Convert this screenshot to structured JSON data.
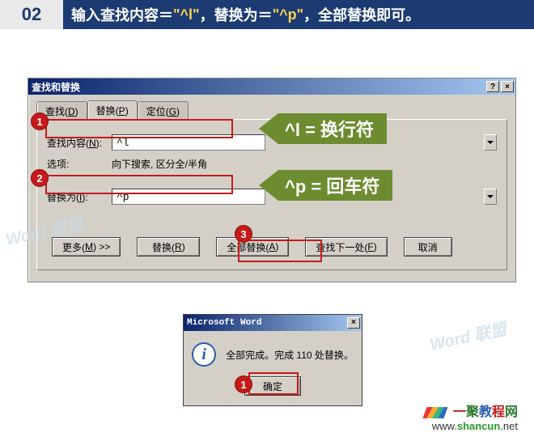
{
  "header": {
    "step": "02",
    "instruction_prefix": "输入查找内容＝",
    "find_quoted": "\"^l\"",
    "instruction_mid": "，替换为＝",
    "replace_quoted": "\"^p\"",
    "instruction_suffix": "，全部替换即可。"
  },
  "dialog": {
    "title": "查找和替换",
    "help_btn": "?",
    "close_btn": "×",
    "tabs": {
      "find": "查找(D)",
      "replace": "替换(P)",
      "goto": "定位(G)"
    },
    "find_label": "查找内容(N):",
    "find_value": "^l",
    "options_label": "选项:",
    "options_value": "向下搜索, 区分全/半角",
    "replace_label": "替换为(I):",
    "replace_value": "^p",
    "buttons": {
      "more": "更多(M) >>",
      "replace": "替换(R)",
      "replace_all": "全部替换(A)",
      "find_next": "查找下一处(F)",
      "cancel": "取消"
    }
  },
  "callouts": {
    "c1": "^l = 换行符",
    "c2": "^p = 回车符"
  },
  "badges": {
    "b1": "1",
    "b2": "2",
    "b3": "3",
    "msg_b1": "1"
  },
  "msgbox": {
    "title": "Microsoft Word",
    "close_btn": "×",
    "icon_letter": "i",
    "message": "全部完成。完成 110 处替换。",
    "ok": "确定"
  },
  "watermarks": {
    "w1": "Word 联盟",
    "w2": "Word 联盟"
  },
  "footer": {
    "logo1": "一聚教程网",
    "logo2_prefix": "www.",
    "logo2_green": "shancun",
    "logo2_suffix": ".net"
  }
}
